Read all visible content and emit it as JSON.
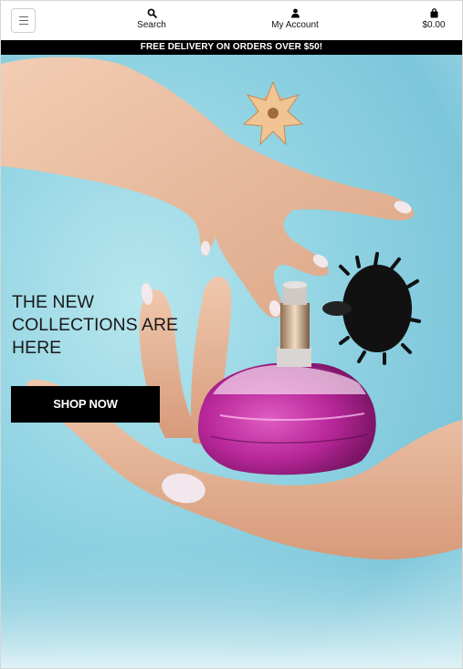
{
  "header": {
    "menu_icon": "hamburger-icon",
    "search": {
      "label": "Search",
      "icon": "search-icon"
    },
    "account": {
      "label": "My Account",
      "icon": "user-icon"
    },
    "cart": {
      "total": "$0.00",
      "icon": "shopping-bag-icon"
    }
  },
  "promo": {
    "text": "FREE DELIVERY ON ORDERS OVER $50!"
  },
  "hero": {
    "title": "THE NEW COLLECTIONS ARE HERE",
    "cta_label": "SHOP NOW",
    "background_color": "#8fd2e2",
    "bottle_color": "#b8279a"
  }
}
